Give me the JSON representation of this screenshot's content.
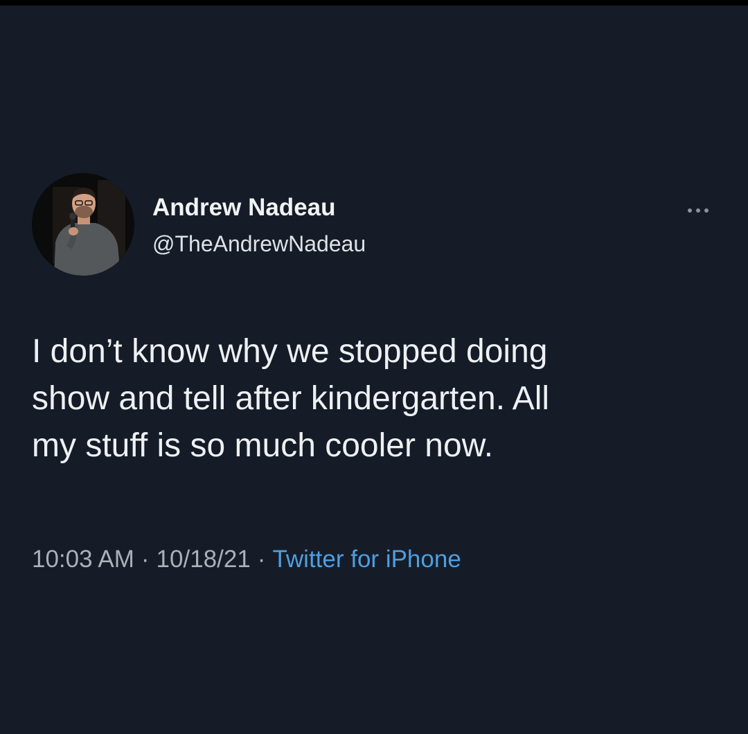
{
  "tweet": {
    "author": {
      "display_name": "Andrew Nadeau",
      "handle": "@TheAndrewNadeau"
    },
    "menu_icon": "more-horizontal-icon",
    "text_lines": [
      "I don’t know why we stopped doing",
      "show and tell after kindergarten. All",
      "my stuff is so much cooler now."
    ],
    "time": "10:03 AM",
    "date": "10/18/21",
    "separator": "·",
    "source": "Twitter for iPhone"
  },
  "colors": {
    "background": "#151c28",
    "text": "#eef0f2",
    "muted": "#a9b0b7",
    "link": "#4e9fe0"
  }
}
